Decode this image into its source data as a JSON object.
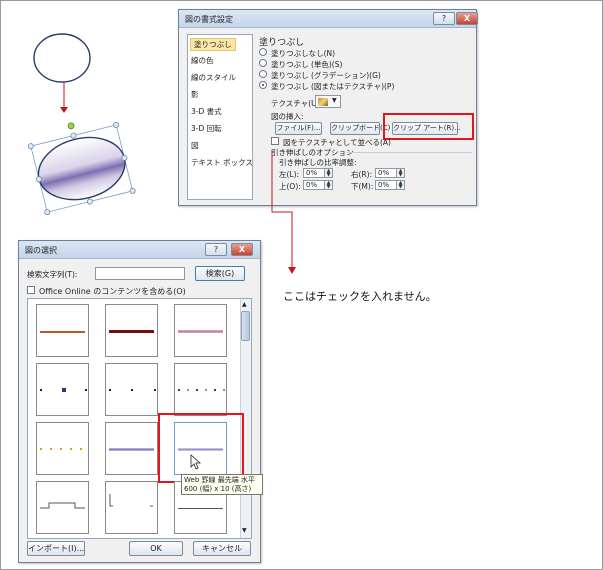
{
  "format_dialog": {
    "title": "図の書式設定",
    "help_button": "?",
    "close_button": "X",
    "nav_items": [
      "塗りつぶし",
      "線の色",
      "線のスタイル",
      "影",
      "3-D 書式",
      "3-D 回転",
      "図",
      "テキスト ボックス"
    ],
    "section_title": "塗りつぶし",
    "fill_options": [
      "塗りつぶしなし(N)",
      "塗りつぶし (単色)(S)",
      "塗りつぶし (グラデーション)(G)",
      "塗りつぶし (図またはテクスチャ)(P)"
    ],
    "selected_fill": "塗りつぶし (図またはテクスチャ)(P)",
    "texture_label": "テクスチャ(U):",
    "insert_label": "図の挿入:",
    "file_button": "ファイル(F)...",
    "clipboard_button": "クリップボード(C)",
    "clipart_button": "クリップ アート(R)...",
    "tile_checkbox": "図をテクスチャとして並べる(A)",
    "stretch_options": "引き伸ばしのオプション",
    "offsets_label": "引き伸ばしの比率調整:",
    "left_label": "左(L):",
    "left_value": "0%",
    "right_label": "右(R):",
    "right_value": "0%",
    "top_label": "上(O):",
    "top_value": "0%",
    "bottom_label": "下(M):",
    "bottom_value": "0%"
  },
  "picture_dialog": {
    "title": "図の選択",
    "help_button": "?",
    "close_button": "X",
    "search_label": "検索文字列(T):",
    "search_value": "",
    "search_button": "検索(G)",
    "online_checkbox": "Office Online のコンテンツを含める(O)",
    "tooltip_line1": "Web 罫線 最先端 水平",
    "tooltip_line2": "600 (幅) x 10 (高さ)",
    "import_button": "インポート(I)...",
    "ok_button": "OK",
    "cancel_button": "キャンセル"
  },
  "annotation": "ここはチェックを入れません。",
  "colors": {
    "highlight_red": "#e8141c",
    "title_gradient": "#c3d4ea",
    "arrow_red": "#c8141c"
  }
}
